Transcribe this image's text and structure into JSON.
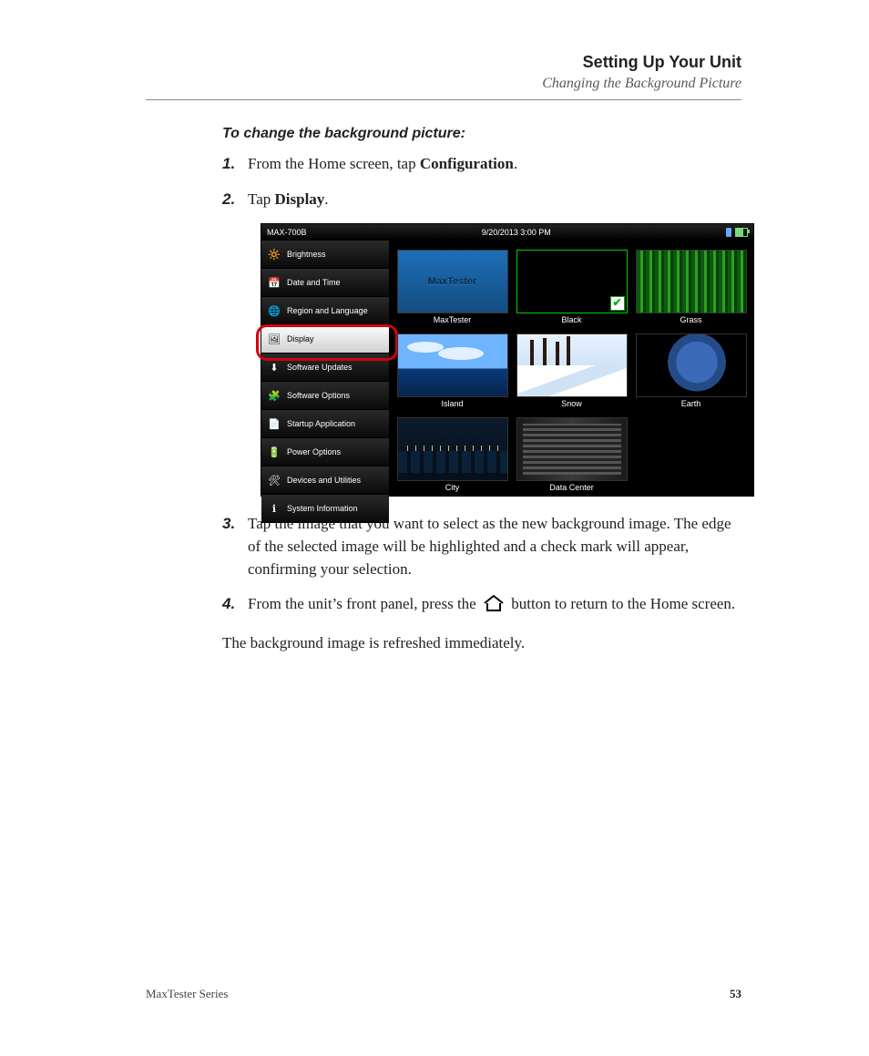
{
  "header": {
    "title": "Setting Up Your Unit",
    "subtitle": "Changing the Background Picture"
  },
  "section_lead": "To change the background picture:",
  "steps": {
    "s1": {
      "num": "1.",
      "pre": "From the Home screen, tap ",
      "bold": "Configuration",
      "post": "."
    },
    "s2": {
      "num": "2.",
      "pre": "Tap ",
      "bold": "Display",
      "post": "."
    },
    "s3": {
      "num": "3.",
      "text": "Tap the image that you want to select as the new background image. The edge of the selected image will be highlighted and a check mark will appear, confirming your selection."
    },
    "s4": {
      "num": "4.",
      "pre": "From the unit’s front panel, press the ",
      "post": " button to return to the Home screen."
    }
  },
  "closing": "The background image is refreshed immediately.",
  "footer": {
    "series": "MaxTester Series",
    "page": "53"
  },
  "screenshot": {
    "device": "MAX-700B",
    "datetime": "9/20/2013 3:00 PM",
    "sidebar": [
      {
        "label": "Brightness",
        "icon": "🔆"
      },
      {
        "label": "Date and Time",
        "icon": "📅"
      },
      {
        "label": "Region and Language",
        "icon": "🌐"
      },
      {
        "label": "Display",
        "icon": "🖼"
      },
      {
        "label": "Software Updates",
        "icon": "⬇"
      },
      {
        "label": "Software Options",
        "icon": "🧩"
      },
      {
        "label": "Startup Application",
        "icon": "📄"
      },
      {
        "label": "Power Options",
        "icon": "🔋"
      },
      {
        "label": "Devices and Utilities",
        "icon": "🛠"
      },
      {
        "label": "System Information",
        "icon": "ℹ"
      }
    ],
    "sidebar_selected_index": 3,
    "thumbs": [
      {
        "label": "MaxTester",
        "brand": "MaxTester"
      },
      {
        "label": "Black"
      },
      {
        "label": "Grass"
      },
      {
        "label": "Island"
      },
      {
        "label": "Snow"
      },
      {
        "label": "Earth"
      },
      {
        "label": "City"
      },
      {
        "label": "Data Center"
      }
    ],
    "thumb_selected_index": 1
  }
}
